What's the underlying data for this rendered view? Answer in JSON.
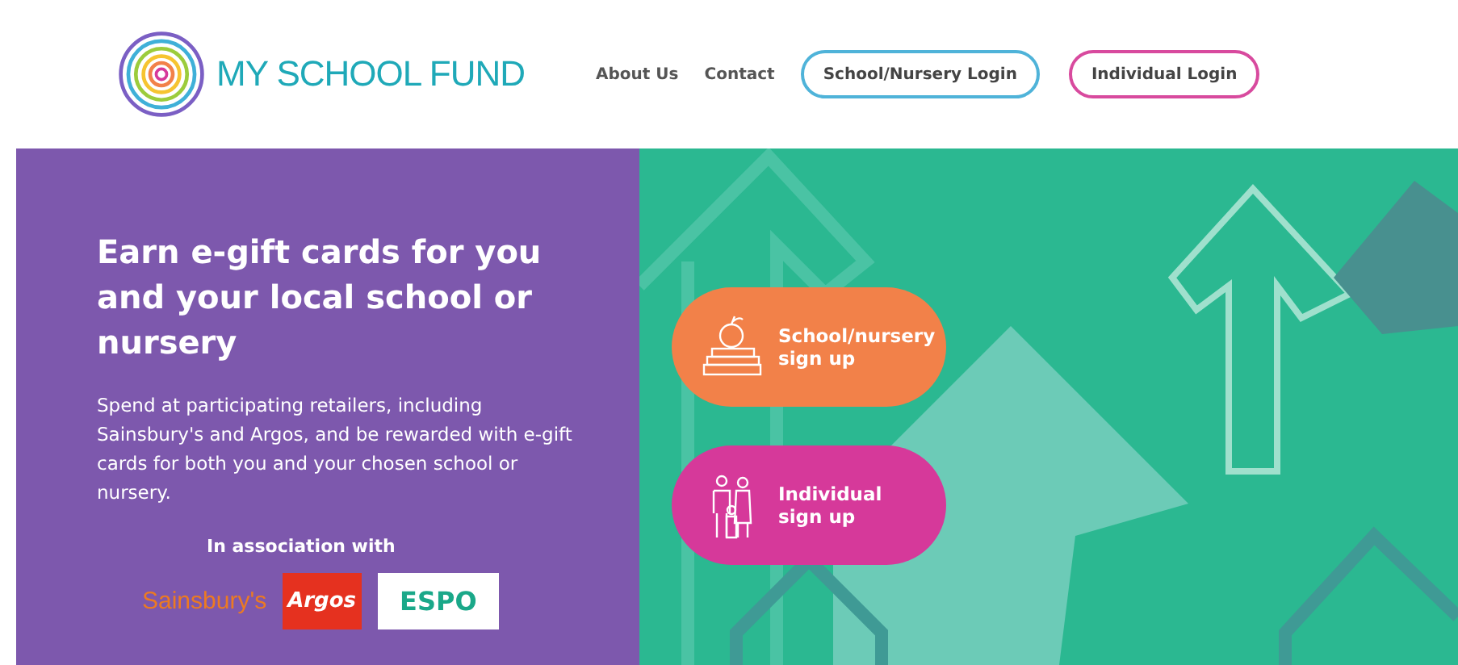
{
  "header": {
    "brand": "MY SCHOOL FUND",
    "nav": [
      "About Us",
      "Contact"
    ],
    "logins": [
      {
        "label": "School/Nursery Login",
        "color": "#4fb3d9"
      },
      {
        "label": "Individual Login",
        "color": "#d84a9e"
      }
    ]
  },
  "hero": {
    "heading": "Earn e-gift cards for you and your local school or nursery",
    "text": "Spend at participating retailers, including Sainsbury's and Argos, and be rewarded with e-gift cards for both you and your chosen school or nursery.",
    "association": "In association with",
    "partners": [
      {
        "kind": "plain",
        "name": "Sainsbury's"
      },
      {
        "kind": "red",
        "name": "Argos"
      },
      {
        "kind": "white",
        "name": "ESPO"
      }
    ]
  },
  "signups": [
    {
      "kind": "school",
      "label": "School/nursery sign up",
      "color": "#f28149"
    },
    {
      "kind": "individual",
      "label": "Individual sign up",
      "color": "#d6399a"
    }
  ]
}
